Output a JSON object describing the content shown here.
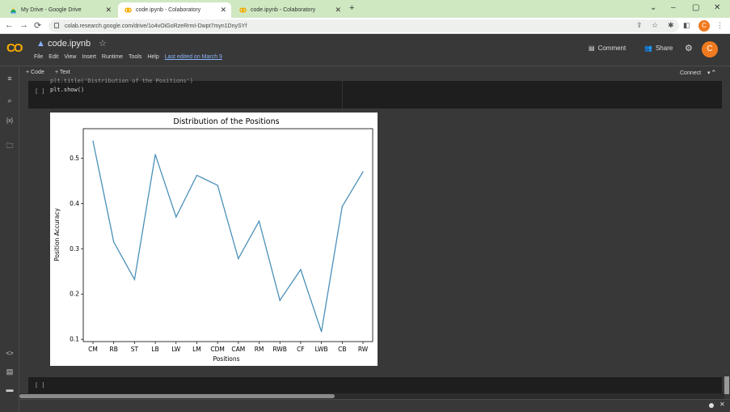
{
  "browser": {
    "tabs": [
      {
        "title": "My Drive - Google Drive",
        "icon": "google-drive-icon",
        "active": false
      },
      {
        "title": "code.ipynb - Colaboratory",
        "icon": "colab-icon",
        "active": true
      },
      {
        "title": "code.ipynb - Colaboratory",
        "icon": "colab-icon",
        "active": false
      }
    ],
    "new_tab": "+",
    "window_controls": {
      "dropdown": "⌄",
      "minimize": "–",
      "maximize": "▢",
      "close": "✕"
    },
    "url": "colab.research.google.com/drive/1o4vOiGoRzeRrmI-Dwpt7myn1DnySYf",
    "nav": {
      "back": "←",
      "forward": "→",
      "reload": "⟳"
    },
    "profile_initial": "C"
  },
  "colab": {
    "logo": "CO",
    "notebook_title": "code.ipynb",
    "star": "☆",
    "menu": [
      "File",
      "Edit",
      "View",
      "Insert",
      "Runtime",
      "Tools",
      "Help"
    ],
    "last_edited": "Last edited on March 9",
    "comment_label": "Comment",
    "share_label": "Share",
    "user_initial": "C"
  },
  "toolbar": {
    "add_code": "+ Code",
    "add_text": "+ Text",
    "connect": "Connect",
    "connect_caret": "▾",
    "collapse": "⌃"
  },
  "left_rail": {
    "menu": "≡",
    "search": "🔍",
    "variables": "{x}",
    "files": "🗀",
    "code_snippets": "<>",
    "terminal": "▤",
    "command_palette": "▬"
  },
  "cells": {
    "code_cell": {
      "bracket": "[ ]",
      "cut_line": "plt.title('Distribution of the Positions')",
      "line": "plt.show()"
    },
    "empty_cell": {
      "bracket": "[ ]"
    }
  },
  "status": {
    "close": "✕"
  },
  "chart_data": {
    "type": "line",
    "title": "Distribution of the Positions",
    "xlabel": "Positions",
    "ylabel": "Position Accuracy",
    "categories": [
      "CM",
      "RB",
      "ST",
      "LB",
      "LW",
      "LM",
      "CDM",
      "CAM",
      "RM",
      "RWB",
      "CF",
      "LWB",
      "CB",
      "RW"
    ],
    "values": [
      0.538,
      0.315,
      0.232,
      0.508,
      0.37,
      0.462,
      0.44,
      0.278,
      0.361,
      0.186,
      0.254,
      0.117,
      0.393,
      0.47
    ],
    "yticks": [
      "0.1",
      "0.2",
      "0.3",
      "0.4",
      "0.5"
    ],
    "ylim": [
      0.095,
      0.565
    ],
    "line_color": "#4a90b8",
    "grid": false
  }
}
